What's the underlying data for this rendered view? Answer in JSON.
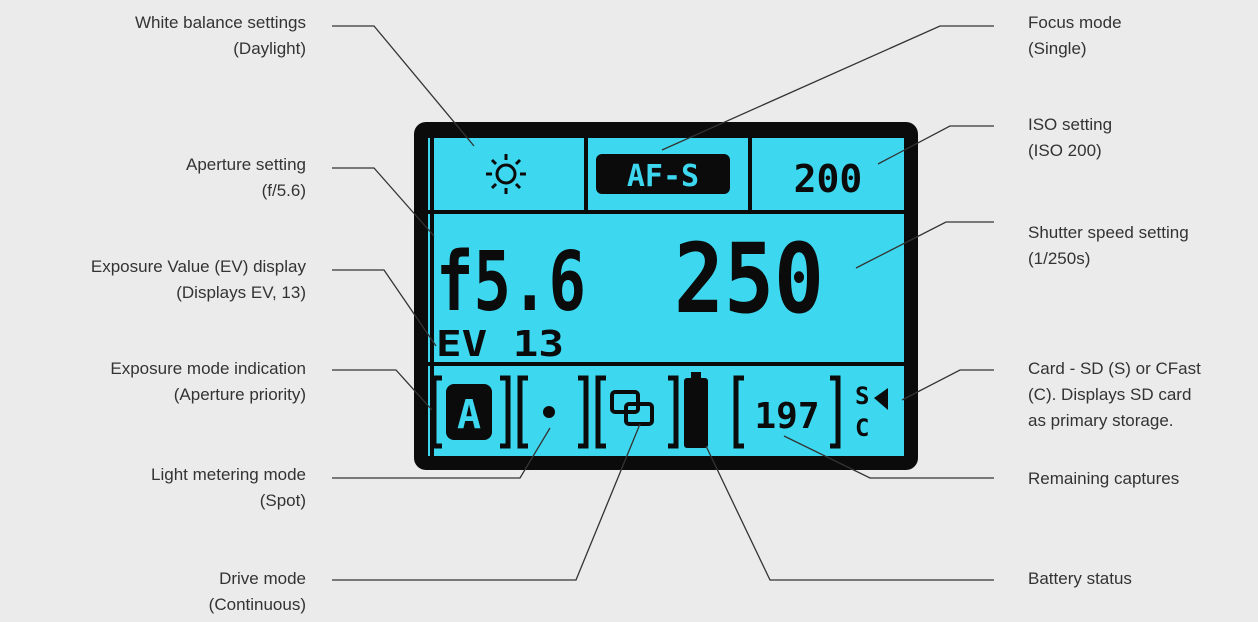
{
  "colors": {
    "lcd_bg": "#3dd8ef",
    "lcd_frame": "#0b0b0b",
    "label_text": "#333333",
    "leader_line": "#333333"
  },
  "lcd": {
    "white_balance_icon": "sun-icon",
    "focus_mode": "AF-S",
    "iso": "200",
    "aperture": "f5.6",
    "shutter": "250",
    "ev": "EV 13",
    "exposure_mode": "A",
    "metering_icon": "spot-metering-icon",
    "drive_icon": "continuous-drive-icon",
    "battery_icon": "battery-icon",
    "remaining": "197",
    "card_indicator": "S C"
  },
  "labels_left": [
    {
      "line1": "White balance settings",
      "line2": "(Daylight)"
    },
    {
      "line1": "Aperture setting",
      "line2": "(f/5.6)"
    },
    {
      "line1": "Exposure Value (EV) display",
      "line2": "(Displays EV, 13)"
    },
    {
      "line1": "Exposure mode indication",
      "line2": "(Aperture priority)"
    },
    {
      "line1": "Light metering mode",
      "line2": "(Spot)"
    },
    {
      "line1": "Drive  mode",
      "line2": "(Continuous)"
    }
  ],
  "labels_right": [
    {
      "line1": "Focus mode",
      "line2": "(Single)"
    },
    {
      "line1": "ISO setting",
      "line2": "(ISO 200)"
    },
    {
      "line1": "Shutter speed setting",
      "line2": "(1/250s)"
    },
    {
      "line1": "Card - SD (S) or CFast",
      "line2": "(C). Displays SD card",
      "line3": "as primary storage."
    },
    {
      "line1": "Remaining captures"
    },
    {
      "line1": "Battery status"
    }
  ]
}
